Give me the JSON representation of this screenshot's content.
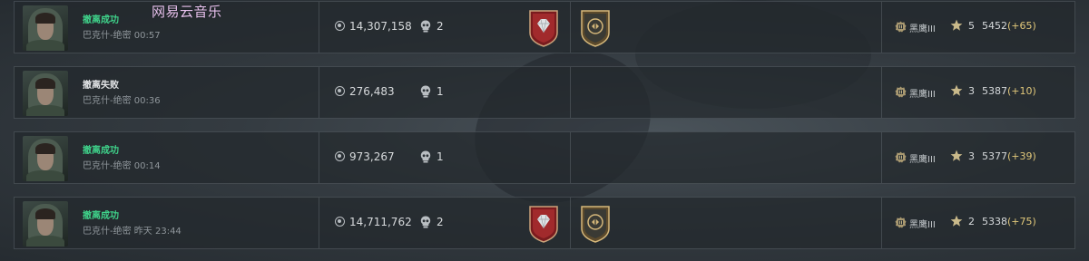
{
  "watermark": "网易云音乐",
  "colors": {
    "success": "#3fd28a",
    "delta": "#e0c77a",
    "badge_red": "#8a1f22",
    "badge_gold": "#b89a5a"
  },
  "icons": {
    "money": "coin-icon",
    "kills": "skull-icon",
    "rank": "rank-emblem-icon",
    "star": "star-icon"
  },
  "records": [
    {
      "status": "撤离成功",
      "status_type": "success",
      "map": "巴克什-绝密",
      "time": "00:57",
      "money": "14,307,158",
      "kills": "2",
      "badges": [
        "diamond-badge",
        "operator-badge"
      ],
      "rank": "黑鹰III",
      "stars": "5",
      "score": "5452",
      "delta": "(+65)"
    },
    {
      "status": "撤离失败",
      "status_type": "fail",
      "map": "巴克什-绝密",
      "time": "00:36",
      "money": "276,483",
      "kills": "1",
      "badges": [],
      "rank": "黑鹰III",
      "stars": "3",
      "score": "5387",
      "delta": "(+10)"
    },
    {
      "status": "撤离成功",
      "status_type": "success",
      "map": "巴克什-绝密",
      "time": "00:14",
      "money": "973,267",
      "kills": "1",
      "badges": [],
      "rank": "黑鹰III",
      "stars": "3",
      "score": "5377",
      "delta": "(+39)"
    },
    {
      "status": "撤离成功",
      "status_type": "success",
      "map": "巴克什-绝密",
      "time": "昨天 23:44",
      "money": "14,711,762",
      "kills": "2",
      "badges": [
        "diamond-badge",
        "operator-badge"
      ],
      "rank": "黑鹰III",
      "stars": "2",
      "score": "5338",
      "delta": "(+75)"
    }
  ]
}
